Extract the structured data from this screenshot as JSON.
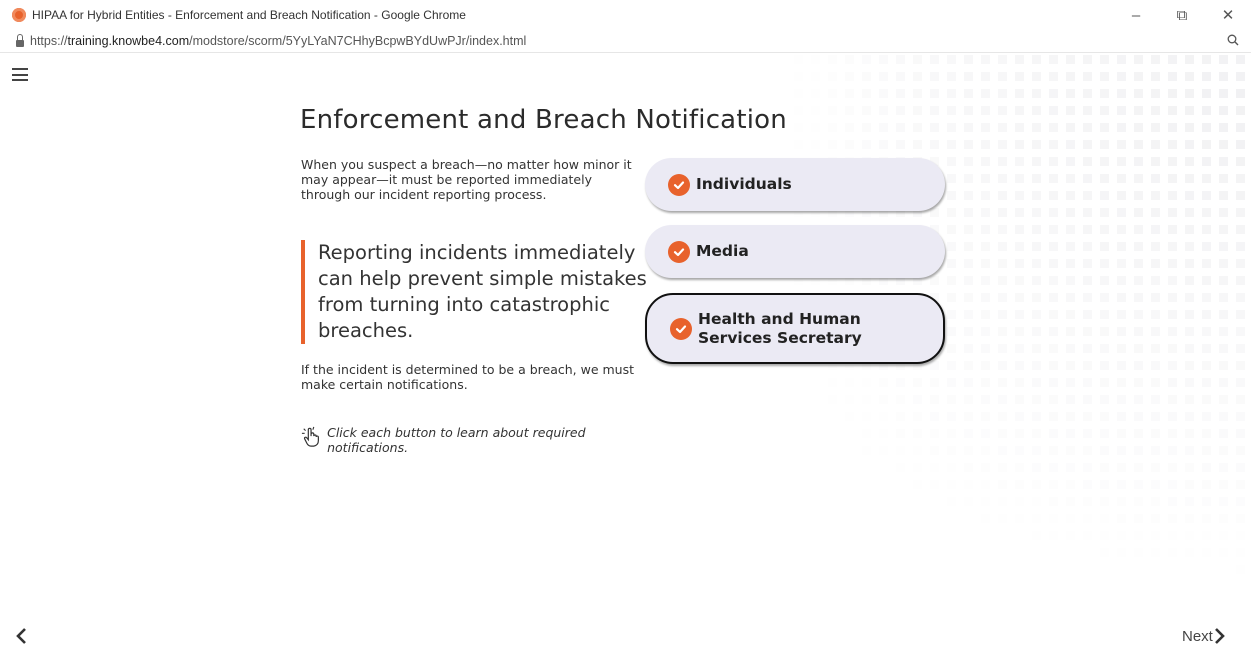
{
  "window": {
    "title": "HIPAA for Hybrid Entities - Enforcement and Breach Notification - Google Chrome",
    "controls": {
      "minimize": "–",
      "restore": "⧉",
      "close": "✕"
    }
  },
  "addressbar": {
    "url_scheme": "https://",
    "url_host": "training.knowbe4.com",
    "url_path": "/modstore/scorm/5YyLYaN7CHhyBcpwBYdUwPJr/index.html",
    "zoom_icon": "magnifier-icon"
  },
  "slide": {
    "title": "Enforcement and Breach Notification",
    "intro": "When you suspect a breach—no matter how minor it may appear—it must be reported immediately through our incident reporting process.",
    "quote": "Reporting incidents immediately can help prevent simple mistakes from turning into catastrophic breaches.",
    "after": "If the incident is determined to be a breach, we must make certain notifications.",
    "hint": "Click each button to learn about required notifications.",
    "buttons": [
      {
        "label": "Individuals",
        "checked": true
      },
      {
        "label": "Media",
        "checked": true
      },
      {
        "label": "Health and Human Services Secretary",
        "checked": true
      }
    ]
  },
  "nav": {
    "next_label": "Next"
  },
  "colors": {
    "accent": "#e8622c",
    "button_bg": "#ebeaf4"
  }
}
